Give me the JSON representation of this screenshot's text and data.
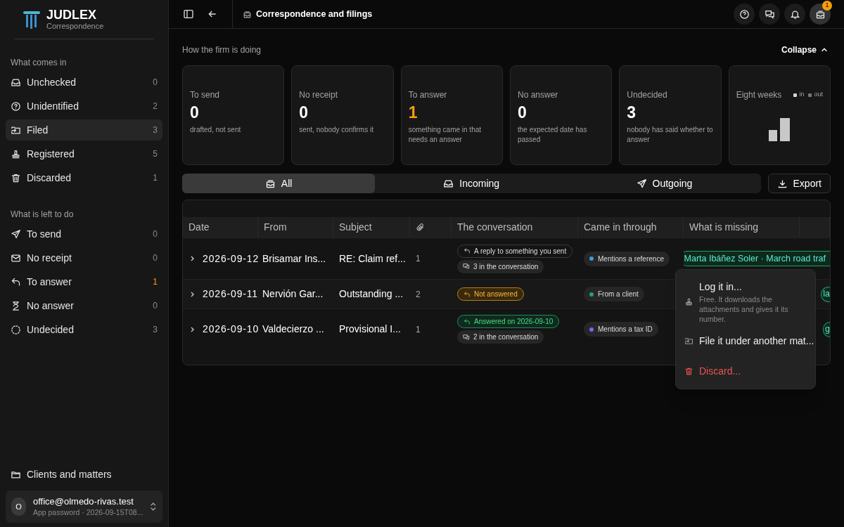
{
  "brand": {
    "name": "JUDLEX",
    "subtitle": "Correspondence"
  },
  "sidebar": {
    "sections": [
      {
        "heading": "What comes in",
        "items": [
          {
            "label": "Unchecked",
            "count": "0",
            "selected": false,
            "alert": false
          },
          {
            "label": "Unidentified",
            "count": "2",
            "selected": false,
            "alert": false
          },
          {
            "label": "Filed",
            "count": "3",
            "selected": true,
            "alert": false
          },
          {
            "label": "Registered",
            "count": "5",
            "selected": false,
            "alert": false
          },
          {
            "label": "Discarded",
            "count": "1",
            "selected": false,
            "alert": false
          }
        ]
      },
      {
        "heading": "What is left to do",
        "items": [
          {
            "label": "To send",
            "count": "0",
            "selected": false,
            "alert": false
          },
          {
            "label": "No receipt",
            "count": "0",
            "selected": false,
            "alert": false
          },
          {
            "label": "To answer",
            "count": "1",
            "selected": false,
            "alert": true
          },
          {
            "label": "No answer",
            "count": "0",
            "selected": false,
            "alert": false
          },
          {
            "label": "Undecided",
            "count": "3",
            "selected": false,
            "alert": false
          }
        ]
      }
    ],
    "footer_link": "Clients and matters",
    "account": {
      "initial": "O",
      "email": "office@olmedo-rivas.test",
      "detail": "App password · 2026-09-15T08..."
    }
  },
  "topbar": {
    "title": "Correspondence and filings",
    "badge": "1"
  },
  "summary": {
    "heading": "How the firm is doing",
    "collapse": "Collapse",
    "cards": [
      {
        "label": "To send",
        "value": "0",
        "note": "drafted, not sent",
        "alert": false
      },
      {
        "label": "No receipt",
        "value": "0",
        "note": "sent, nobody confirms it",
        "alert": false
      },
      {
        "label": "To answer",
        "value": "1",
        "note": "something came in that needs an answer",
        "alert": true
      },
      {
        "label": "No answer",
        "value": "0",
        "note": "the expected date has passed",
        "alert": false
      },
      {
        "label": "Undecided",
        "value": "3",
        "note": "nobody has said whether to answer",
        "alert": false
      }
    ],
    "chart_card": {
      "title": "Eight weeks",
      "legend": [
        "in",
        "out"
      ]
    }
  },
  "filters": {
    "tabs": [
      {
        "label": "All",
        "selected": true
      },
      {
        "label": "Incoming",
        "selected": false
      },
      {
        "label": "Outgoing",
        "selected": false
      }
    ],
    "export": "Export"
  },
  "table": {
    "columns": [
      "Date",
      "From",
      "Subject",
      "",
      "The conversation",
      "Came in through",
      "What is missing"
    ],
    "rows": [
      {
        "date": "2026-09-12",
        "from": "Brisamar Ins...",
        "subject": "RE: Claim ref...",
        "attachments": "1",
        "conversation": [
          {
            "kind": "neutral",
            "text": "A reply to something you sent"
          },
          {
            "kind": "count",
            "text": "3 in the conversation"
          }
        ],
        "channel": {
          "text": "Mentions a reference",
          "color": "#3b9be0"
        },
        "missing": "Marta Ibáñez Soler · March road traf"
      },
      {
        "date": "2026-09-11",
        "from": "Nervión Gar...",
        "subject": "Outstanding ...",
        "attachments": "2",
        "conversation": [
          {
            "kind": "warning",
            "text": "Not answered"
          }
        ],
        "channel": {
          "text": "From a client",
          "color": "#22a06b"
        },
        "missing": "la"
      },
      {
        "date": "2026-09-10",
        "from": "Valdecierzo ...",
        "subject": "Provisional I...",
        "attachments": "1",
        "conversation": [
          {
            "kind": "success",
            "text": "Answered on 2026-09-10"
          },
          {
            "kind": "count",
            "text": "2 in the conversation"
          }
        ],
        "channel": {
          "text": "Mentions a tax ID",
          "color": "#8b5cf6"
        },
        "missing": "g"
      }
    ]
  },
  "menu": {
    "items": [
      {
        "kind": "option",
        "label": "Log it in...",
        "description": "Free. It downloads the attachments and gives it its number."
      },
      {
        "kind": "option",
        "label": "File it under another mat..."
      },
      {
        "kind": "danger",
        "label": "Discard..."
      }
    ]
  }
}
